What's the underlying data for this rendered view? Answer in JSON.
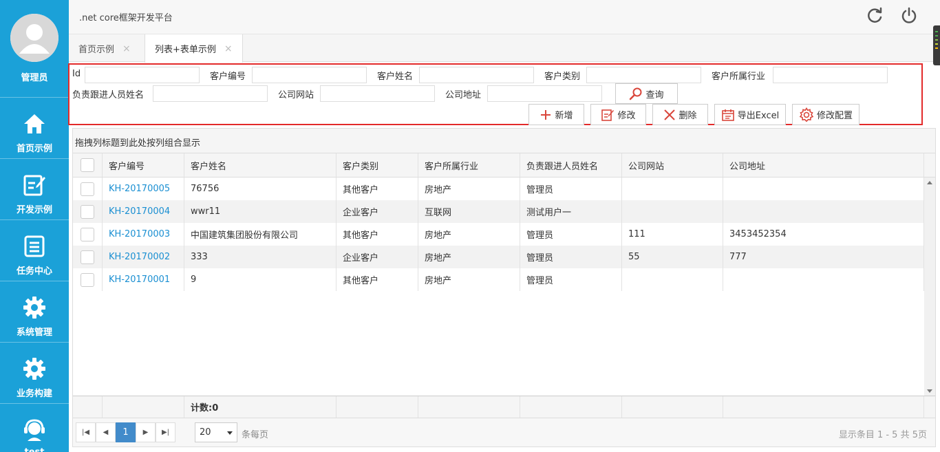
{
  "app": {
    "title": ".net core框架开发平台"
  },
  "user": {
    "name": "管理员"
  },
  "sidebar": {
    "items": [
      {
        "label": "首页示例",
        "icon": "home-icon"
      },
      {
        "label": "开发示例",
        "icon": "edit-icon"
      },
      {
        "label": "任务中心",
        "icon": "task-list-icon"
      },
      {
        "label": "系统管理",
        "icon": "gear-icon"
      },
      {
        "label": "业务构建",
        "icon": "gear-icon"
      },
      {
        "label": "test",
        "icon": "support-agent-icon"
      }
    ]
  },
  "tabs": [
    {
      "label": "首页示例",
      "close": "×"
    },
    {
      "label": "列表+表单示例",
      "close": "×"
    }
  ],
  "search": {
    "fields": {
      "id": "Id",
      "code": "客户编号",
      "name": "客户姓名",
      "type": "客户类别",
      "industry": "客户所属行业",
      "owner": "负责跟进人员姓名",
      "website": "公司网站",
      "address": "公司地址"
    },
    "query_button": "查询"
  },
  "toolbar": {
    "add": "新增",
    "edit": "修改",
    "delete": "删除",
    "export": "导出Excel",
    "config": "修改配置"
  },
  "grid": {
    "group_hint": "拖拽列标题到此处按列组合显示",
    "columns": [
      "客户编号",
      "客户姓名",
      "客户类别",
      "客户所属行业",
      "负责跟进人员姓名",
      "公司网站",
      "公司地址"
    ],
    "rows": [
      [
        "KH-20170005",
        "76756",
        "其他客户",
        "房地产",
        "管理员",
        "",
        ""
      ],
      [
        "KH-20170004",
        "wwr11",
        "企业客户",
        "互联网",
        "测试用户一",
        "",
        ""
      ],
      [
        "KH-20170003",
        "中国建筑集团股份有限公司",
        "其他客户",
        "房地产",
        "管理员",
        "111",
        "3453452354"
      ],
      [
        "KH-20170002",
        "333",
        "企业客户",
        "房地产",
        "管理员",
        "55",
        "777"
      ],
      [
        "KH-20170001",
        "9",
        "其他客户",
        "房地产",
        "管理员",
        "",
        ""
      ]
    ],
    "footer_count": "计数:0"
  },
  "pager": {
    "current_page": "1",
    "page_size": "20",
    "per_page_label": "条每页",
    "summary": "显示条目 1 - 5 共 5页"
  },
  "colors": {
    "sidebar": "#1ba1d8",
    "highlight_border": "#e32a2a",
    "link": "#1a8fd2",
    "pager_active": "#428bca",
    "toolbar_icon": "#d9463b"
  }
}
